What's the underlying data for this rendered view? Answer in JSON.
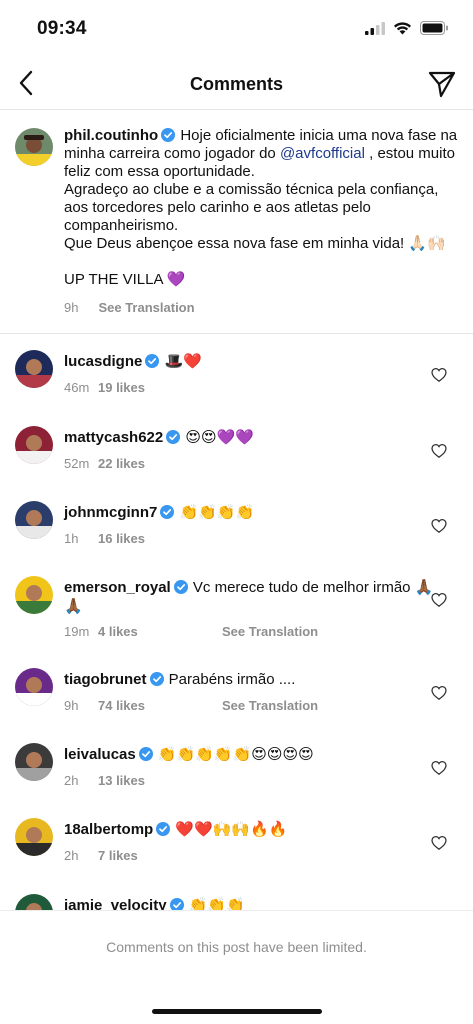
{
  "status": {
    "time": "09:34"
  },
  "nav": {
    "title": "Comments"
  },
  "caption": {
    "username": "phil.coutinho",
    "text1": " Hoje oficialmente inicia uma nova fase na minha carreira como jogador do ",
    "mention": "@avfcofficial",
    "text2": " , estou muito feliz com essa oportunidade.",
    "line2": "Agradeço ao clube e a comissão técnica pela confiança, aos torcedores pelo carinho e aos atletas pelo companheirismo.",
    "line3": "Que Deus abençoe essa nova fase em minha vida! 🙏🏻🙌🏻",
    "line4": "UP THE VILLA 💜",
    "time": "9h",
    "translation": "See Translation"
  },
  "comments": [
    {
      "username": "lucasdigne",
      "text": "🎩❤️",
      "time": "46m",
      "likes": "19 likes",
      "translation": ""
    },
    {
      "username": "mattycash622",
      "text": "😍😍💜💜",
      "time": "52m",
      "likes": "22 likes",
      "translation": ""
    },
    {
      "username": "johnmcginn7",
      "text": "👏👏👏👏",
      "time": "1h",
      "likes": "16 likes",
      "translation": ""
    },
    {
      "username": "emerson_royal",
      "text": "Vc merece tudo de melhor irmão 🙏🏾🙏🏾",
      "time": "19m",
      "likes": "4 likes",
      "translation": "See Translation"
    },
    {
      "username": "tiagobrunet",
      "text": "Parabéns irmão ....",
      "time": "9h",
      "likes": "74 likes",
      "translation": "See Translation"
    },
    {
      "username": "leivalucas",
      "text": "👏👏👏👏👏😍😍😍😍",
      "time": "2h",
      "likes": "13 likes",
      "translation": ""
    },
    {
      "username": "18albertomp",
      "text": "❤️❤️🙌🙌🔥🔥",
      "time": "2h",
      "likes": "7 likes",
      "translation": ""
    },
    {
      "username": "jamie_velocity",
      "text": "👏👏👏",
      "time": "",
      "likes": "",
      "translation": ""
    }
  ],
  "footer": {
    "note": "Comments on this post have been limited."
  },
  "icons": {
    "back": "chevron-left-icon",
    "send": "paper-plane-icon",
    "heart": "heart-outline-icon",
    "verified": "verified-badge-icon"
  },
  "colors": {
    "verified": "#3897f0",
    "mention": "#1e3a8a",
    "meta": "#8e8e8e"
  }
}
